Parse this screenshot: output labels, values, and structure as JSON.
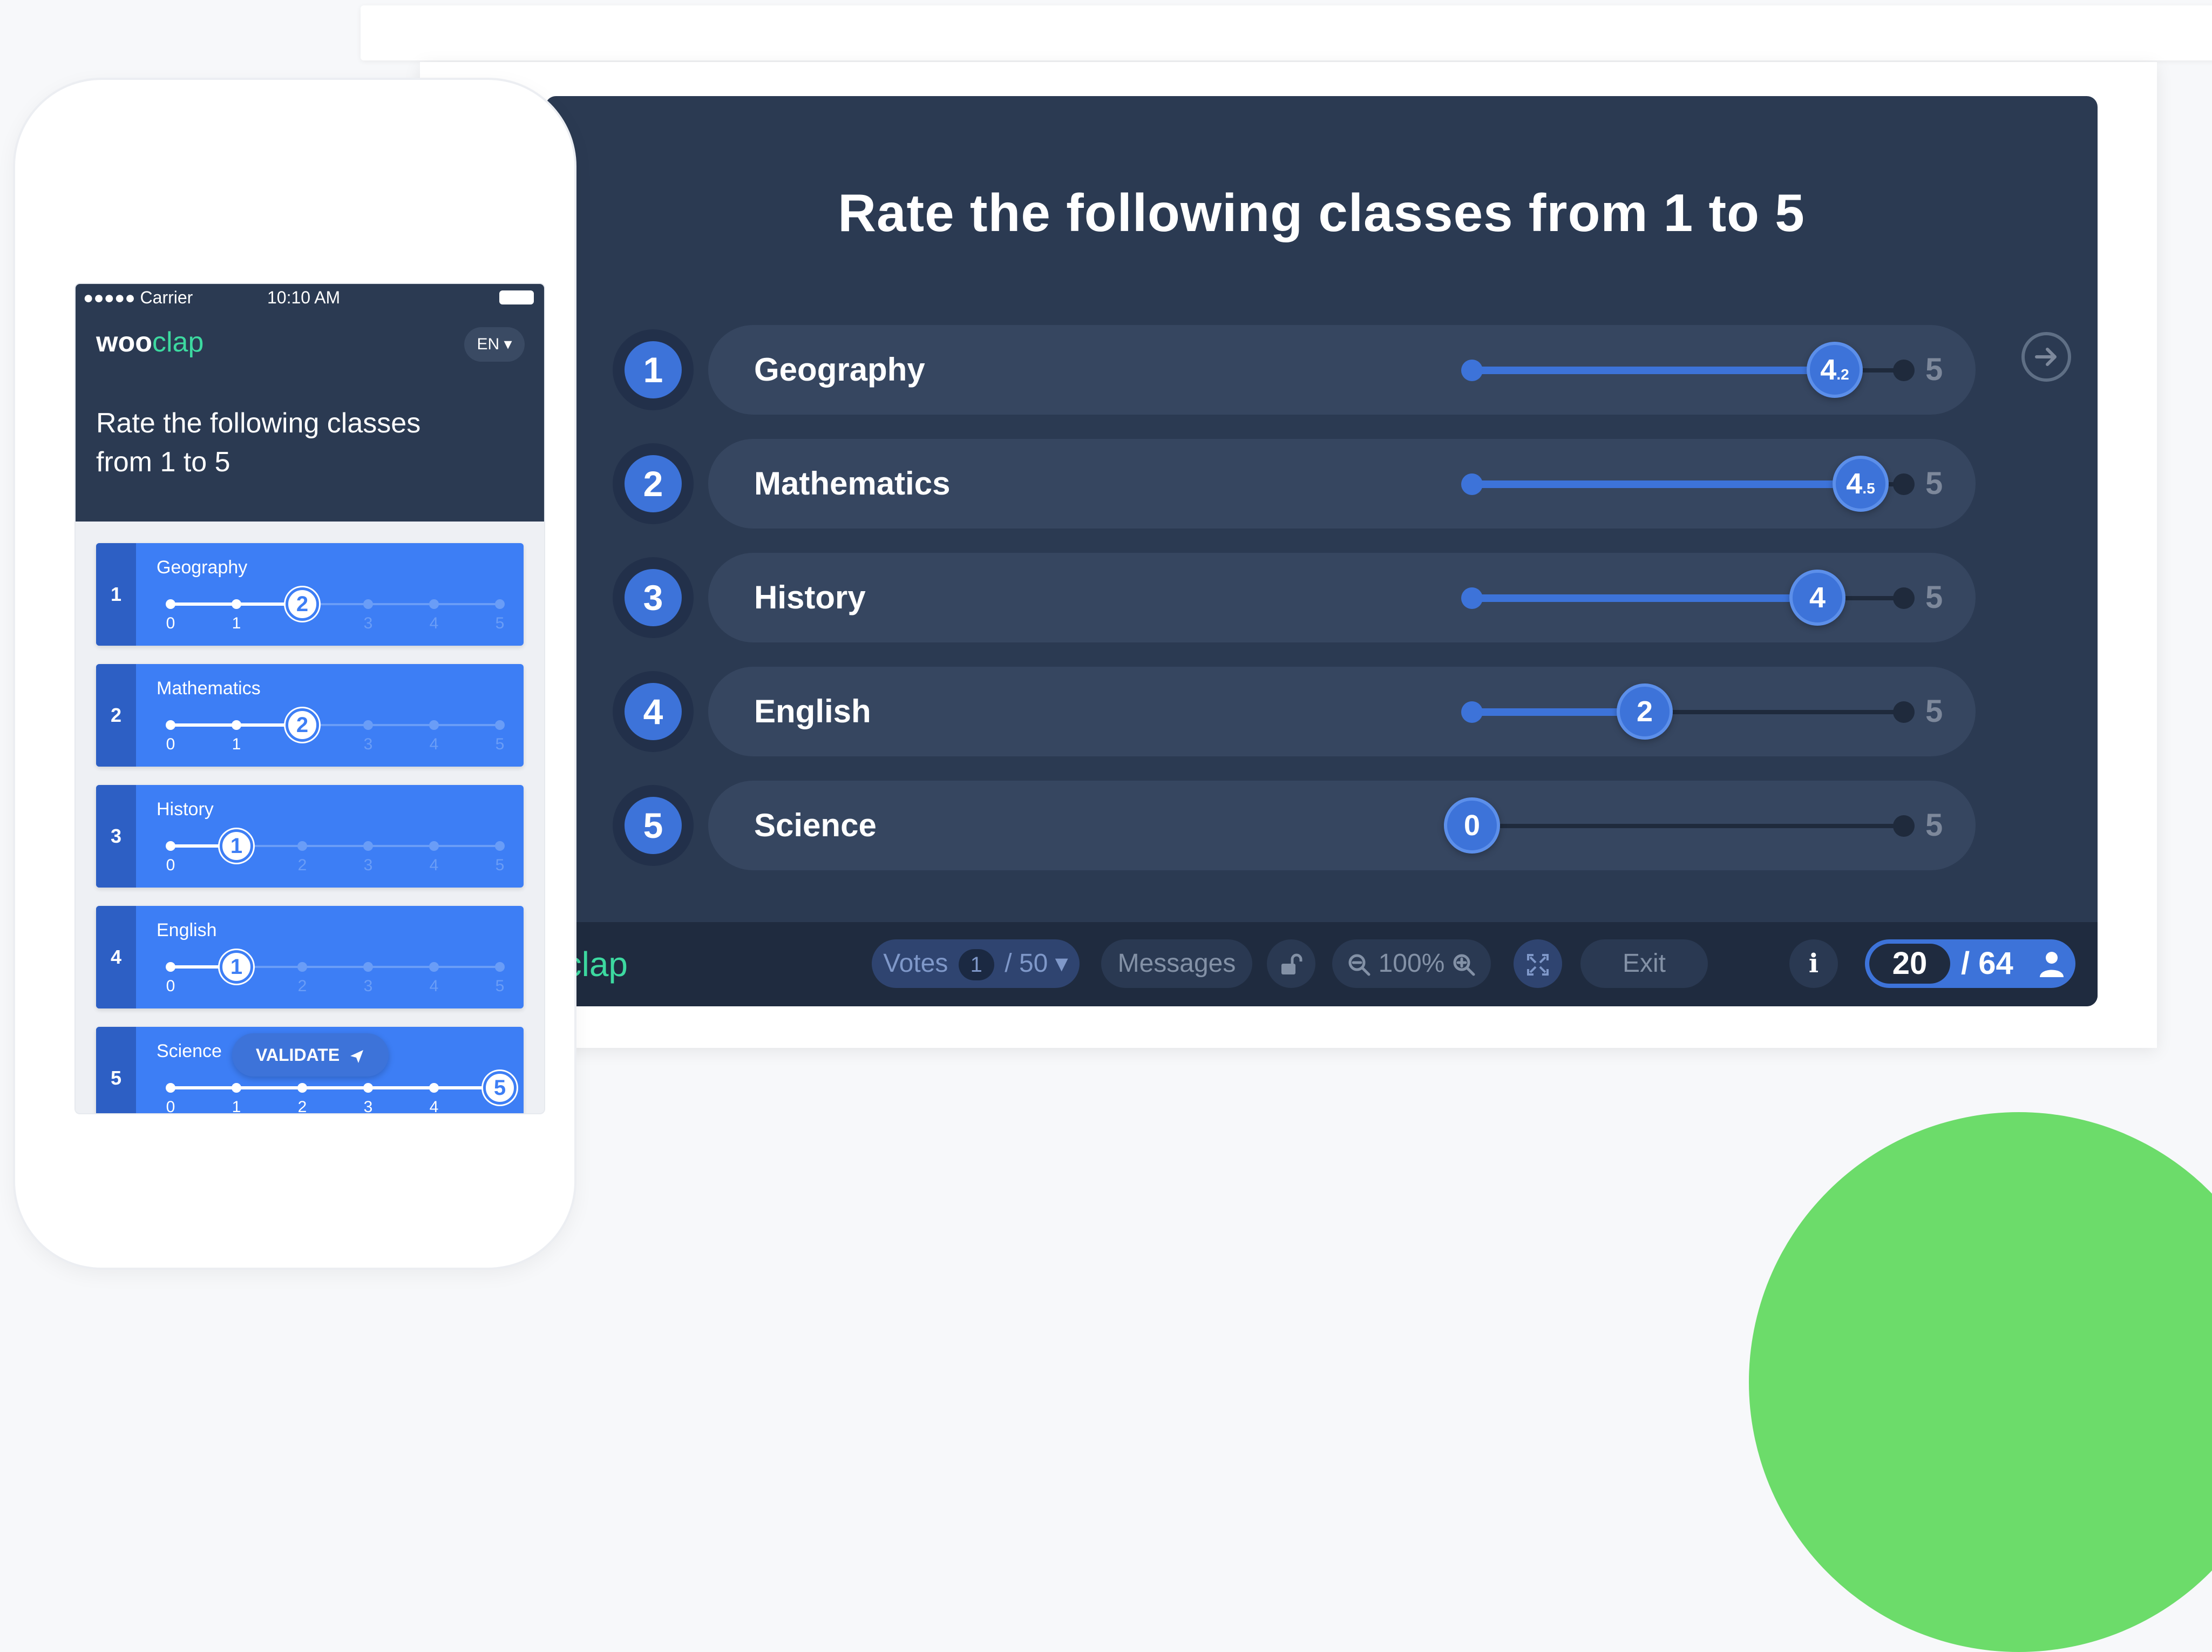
{
  "presentation": {
    "title": "Rate the following classes from 1 to 5",
    "rows": [
      {
        "index": "1",
        "label": "Geography",
        "value_main": "4",
        "value_sub": ".2",
        "value": 4.2,
        "max": "5"
      },
      {
        "index": "2",
        "label": "Mathematics",
        "value_main": "4",
        "value_sub": ".5",
        "value": 4.5,
        "max": "5"
      },
      {
        "index": "3",
        "label": "History",
        "value_main": "4",
        "value_sub": "",
        "value": 4,
        "max": "5"
      },
      {
        "index": "4",
        "label": "English",
        "value_main": "2",
        "value_sub": "",
        "value": 2,
        "max": "5"
      },
      {
        "index": "5",
        "label": "Science",
        "value_main": "0",
        "value_sub": "",
        "value": 0,
        "max": "5"
      }
    ],
    "toolbar": {
      "logo": "oclap",
      "votes_label": "Votes",
      "votes_count": "1",
      "votes_total": "/ 50",
      "messages_label": "Messages",
      "zoom_label": "100%",
      "exit_label": "Exit",
      "info_label": "i",
      "participants_current": "20",
      "participants_total": "/ 64"
    }
  },
  "phone": {
    "status": {
      "carrier": "●●●●● Carrier",
      "time": "10:10 AM"
    },
    "logo_woo": "woo",
    "logo_clap": "clap",
    "language": "EN ▾",
    "question": "Rate the following classes from 1 to 5",
    "cards": [
      {
        "index": "1",
        "label": "Geography",
        "value": "2",
        "ticks": [
          "0",
          "1",
          "2",
          "3",
          "4",
          "5"
        ]
      },
      {
        "index": "2",
        "label": "Mathematics",
        "value": "2",
        "ticks": [
          "0",
          "1",
          "2",
          "3",
          "4",
          "5"
        ]
      },
      {
        "index": "3",
        "label": "History",
        "value": "1",
        "ticks": [
          "0",
          "1",
          "2",
          "3",
          "4",
          "5"
        ]
      },
      {
        "index": "4",
        "label": "English",
        "value": "1",
        "ticks": [
          "0",
          "1",
          "2",
          "3",
          "4",
          "5"
        ]
      },
      {
        "index": "5",
        "label": "Science",
        "value": "5",
        "ticks": [
          "0",
          "1",
          "2",
          "3",
          "4",
          "5"
        ]
      }
    ],
    "validate_label": "VALIDATE"
  },
  "colors": {
    "panel": "#2b3a52",
    "accent_blue": "#3d73d9",
    "card_blue": "#3d7ef5",
    "brand_green": "#3dd9a0",
    "decor_green": "#6cdc6a"
  }
}
